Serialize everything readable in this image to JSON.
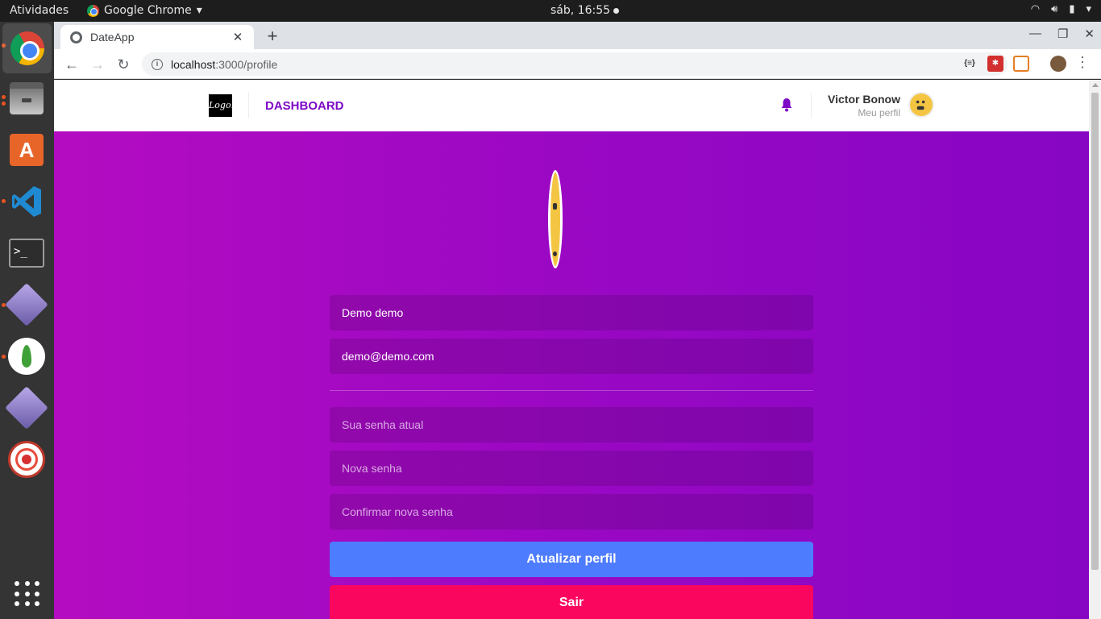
{
  "system_bar": {
    "activities": "Atividades",
    "app_name": "Google Chrome",
    "clock": "sáb, 16:55"
  },
  "browser": {
    "tab_title": "DateApp",
    "url_host": "localhost",
    "url_path": ":3000/profile",
    "new_tab": "+",
    "tab_close": "✕",
    "window_minimize": "—",
    "window_restore": "❐",
    "window_close": "✕"
  },
  "header": {
    "logo_text": "Logo.",
    "nav_link": "DASHBOARD",
    "user_name": "Victor Bonow",
    "user_link": "Meu perfil"
  },
  "profile_form": {
    "name_value": "Demo demo",
    "email_value": "demo@demo.com",
    "old_password_placeholder": "Sua senha atual",
    "new_password_placeholder": "Nova senha",
    "confirm_password_placeholder": "Confirmar nova senha",
    "submit_label": "Atualizar perfil",
    "logout_label": "Sair"
  },
  "colors": {
    "gradient_start": "#b40cc1",
    "gradient_end": "#8606c4",
    "accent_purple": "#7d08c6",
    "update_button": "#4d7cfe",
    "logout_button": "#fb065f"
  },
  "icons": {
    "dock": [
      "chrome-icon",
      "files-icon",
      "software-center-icon",
      "vscode-icon",
      "terminal-icon",
      "gem-icon",
      "mongodb-icon",
      "gem-icon",
      "atom-icon",
      "show-apps-icon"
    ],
    "header": [
      "logo",
      "bell-icon",
      "avatar"
    ]
  }
}
